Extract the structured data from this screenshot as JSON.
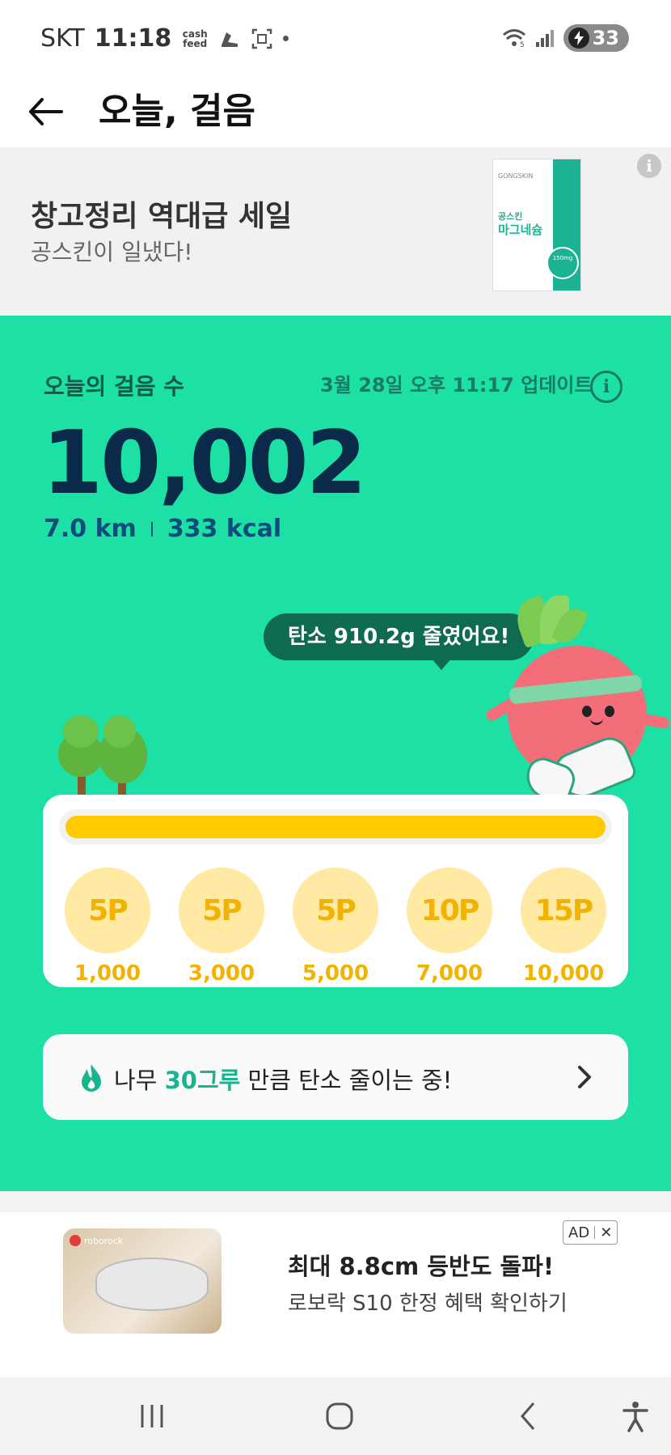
{
  "status_bar": {
    "carrier": "SKT",
    "time": "11:18",
    "cashfeed_line1": "cash",
    "cashfeed_line2": "feed",
    "wifi_badge": "5",
    "battery": "33"
  },
  "header": {
    "title": "오늘, 걸음"
  },
  "promo": {
    "title": "창고정리 역대급 세일",
    "subtitle": "공스킨이 일냈다!",
    "product_brand": "GONGSKIN",
    "product_name_line1": "공스킨",
    "product_name_line2": "마그네슘",
    "product_mg": "150mg"
  },
  "steps": {
    "label": "오늘의 걸음 수",
    "updated": "3월 28일 오후 11:17 업데이트",
    "count": "10,002",
    "distance": "7.0 km",
    "calories": "333 kcal",
    "carbon_bubble": "탄소 910.2g 줄였어요!"
  },
  "progress": {
    "fraction": 1.0,
    "milestones": [
      {
        "reward": "5P",
        "steps": "1,000"
      },
      {
        "reward": "5P",
        "steps": "3,000"
      },
      {
        "reward": "5P",
        "steps": "5,000"
      },
      {
        "reward": "10P",
        "steps": "7,000"
      },
      {
        "reward": "15P",
        "steps": "10,000"
      }
    ]
  },
  "tree_card": {
    "prefix": "나무 ",
    "highlight": "30그루",
    "suffix": " 만큼 탄소 줄이는 중!"
  },
  "ad": {
    "brand": "roborock",
    "title": "최대 8.8cm 등반도 돌파!",
    "subtitle": "로보락 S10 한정 혜택 확인하기",
    "badge": "AD",
    "close": "✕"
  },
  "colors": {
    "green_bg": "#1de0a4",
    "bar_yellow": "#ffca00",
    "coin_bg": "#ffe9a3",
    "highlight": "#17b58e"
  }
}
